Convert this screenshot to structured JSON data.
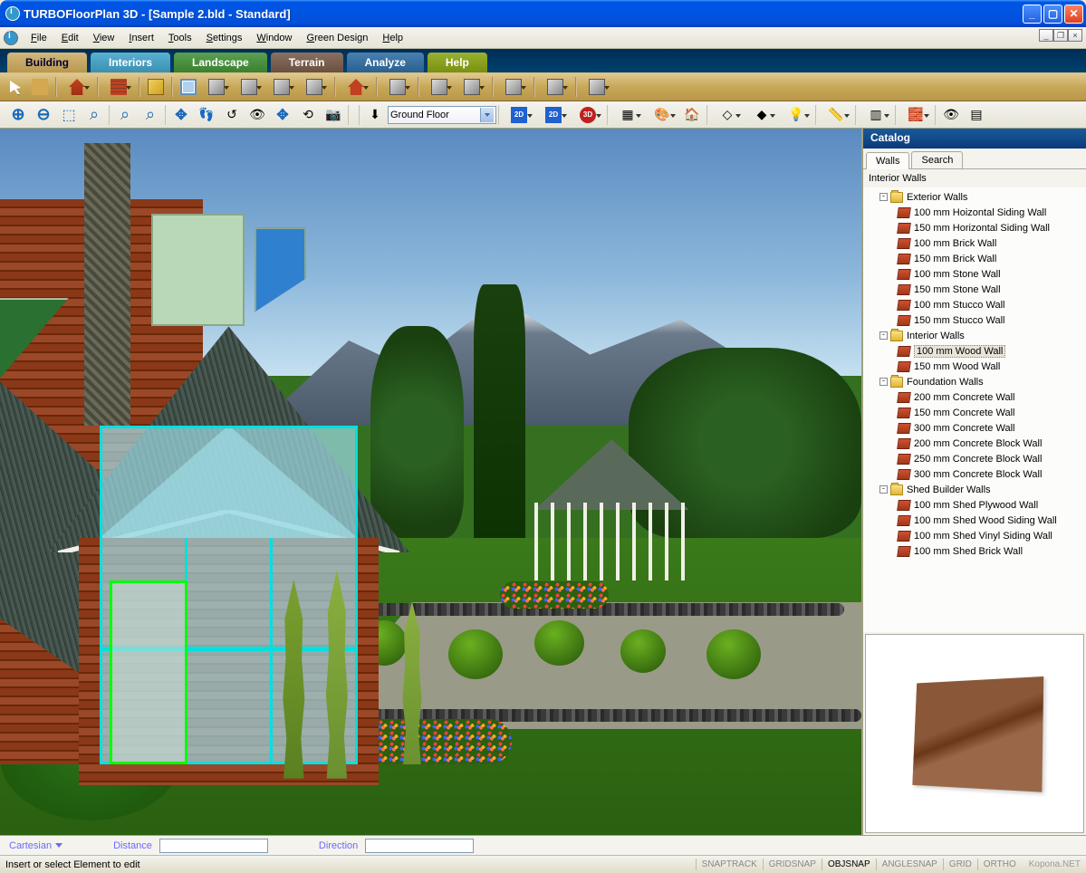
{
  "title": "TURBOFloorPlan 3D - [Sample 2.bld - Standard]",
  "menus": [
    "File",
    "Edit",
    "View",
    "Insert",
    "Tools",
    "Settings",
    "Window",
    "Green Design",
    "Help"
  ],
  "ribbon_tabs": {
    "building": "Building",
    "interiors": "Interiors",
    "landscape": "Landscape",
    "terrain": "Terrain",
    "analyze": "Analyze",
    "help": "Help"
  },
  "floor_selector": "Ground Floor",
  "catalog": {
    "title": "Catalog",
    "tabs": {
      "walls": "Walls",
      "search": "Search"
    },
    "section": "Interior Walls",
    "groups": [
      {
        "name": "Exterior Walls",
        "items": [
          "100 mm Hoizontal Siding Wall",
          "150 mm Horizontal Siding Wall",
          "100 mm Brick Wall",
          "150 mm Brick Wall",
          "100 mm Stone Wall",
          "150 mm Stone Wall",
          "100 mm Stucco Wall",
          "150 mm Stucco Wall"
        ]
      },
      {
        "name": "Interior Walls",
        "items": [
          "100 mm Wood Wall",
          "150 mm Wood Wall"
        ],
        "selected_index": 0
      },
      {
        "name": "Foundation Walls",
        "items": [
          "200 mm Concrete Wall",
          "150 mm Concrete Wall",
          "300 mm Concrete Wall",
          "200 mm Concrete Block Wall",
          "250 mm Concrete Block Wall",
          "300 mm Concrete Block Wall"
        ]
      },
      {
        "name": "Shed Builder Walls",
        "items": [
          "100 mm Shed Plywood Wall",
          "100 mm Shed Wood Siding Wall",
          "100 mm Shed Vinyl Siding Wall",
          "100 mm Shed Brick Wall"
        ]
      }
    ]
  },
  "coords": {
    "mode": "Cartesian",
    "distance_label": "Distance",
    "direction_label": "Direction"
  },
  "status": {
    "message": "Insert or select Element to edit",
    "toggles": [
      "SNAPTRACK",
      "GRIDSNAP",
      "OBJSNAP",
      "ANGLESNAP",
      "GRID",
      "ORTHO"
    ],
    "active": [
      2
    ]
  },
  "watermark": "Kopona.NET"
}
